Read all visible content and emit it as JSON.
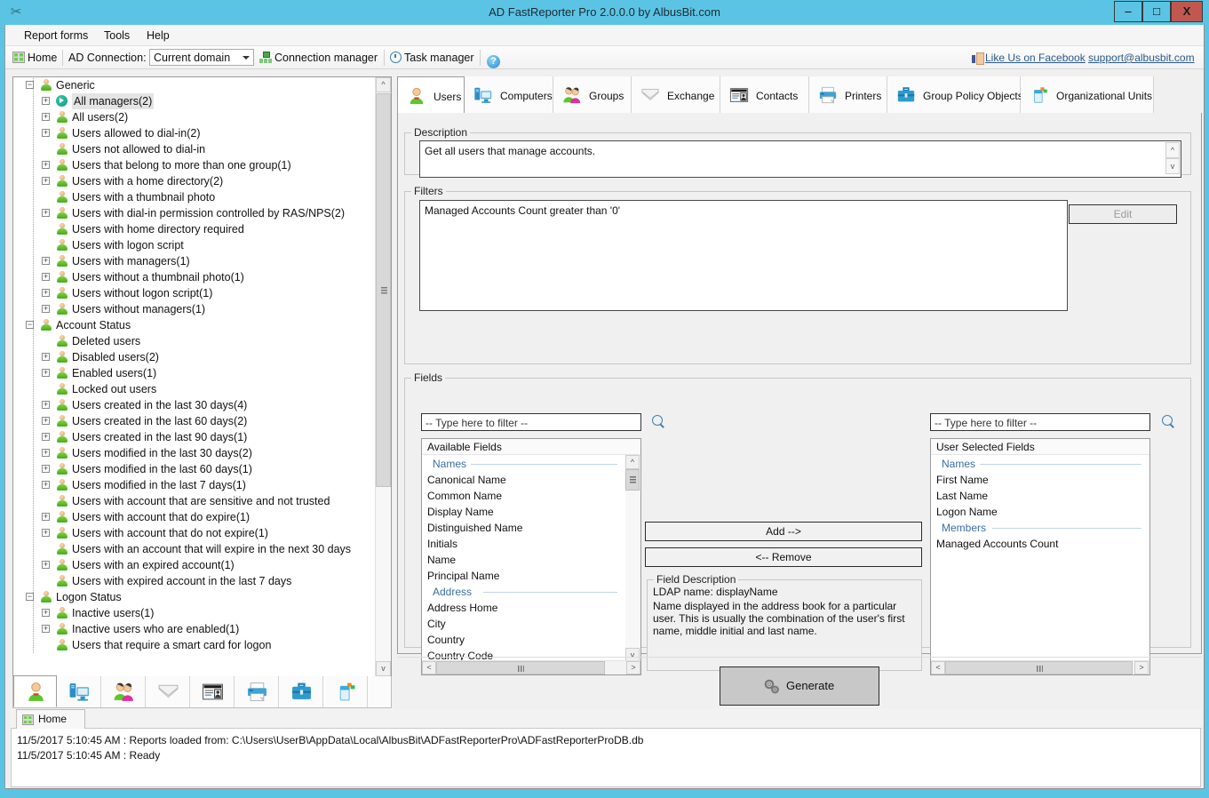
{
  "window": {
    "title": "AD FastReporter Pro 2.0.0.0 by AlbusBit.com",
    "app_icon": "scissors-icon",
    "minimize": "–",
    "maximize": "□",
    "close": "X",
    "titlebar_color": "#5bc4e4",
    "close_color": "#c1584f"
  },
  "menu": {
    "items": [
      {
        "label": "Report forms"
      },
      {
        "label": "Tools"
      },
      {
        "label": "Help"
      }
    ]
  },
  "toolbar": {
    "home": "Home",
    "connection_label": "AD Connection:",
    "connection_value": "Current domain",
    "connection_manager": "Connection manager",
    "task_manager": "Task manager",
    "help": "?",
    "facebook": "Like Us on Facebook",
    "support": "support@albusbit.com"
  },
  "tree": {
    "nodes": [
      {
        "label": "Generic",
        "depth": 0,
        "expander": "−",
        "icon": "person-icon",
        "selected": false
      },
      {
        "label": "All managers(2)",
        "depth": 1,
        "expander": "+",
        "icon": "arrow-circle-icon",
        "selected": true
      },
      {
        "label": "All users(2)",
        "depth": 1,
        "expander": "+",
        "icon": "person-icon",
        "selected": false
      },
      {
        "label": "Users allowed to dial-in(2)",
        "depth": 1,
        "expander": "+",
        "icon": "person-icon",
        "selected": false
      },
      {
        "label": "Users not allowed to dial-in",
        "depth": 1,
        "expander": "",
        "icon": "person-icon",
        "selected": false
      },
      {
        "label": "Users that belong to more than one group(1)",
        "depth": 1,
        "expander": "+",
        "icon": "person-icon",
        "selected": false
      },
      {
        "label": "Users with a home directory(2)",
        "depth": 1,
        "expander": "+",
        "icon": "person-icon",
        "selected": false
      },
      {
        "label": "Users with a thumbnail photo",
        "depth": 1,
        "expander": "",
        "icon": "person-icon",
        "selected": false
      },
      {
        "label": "Users with dial-in permission controlled by RAS/NPS(2)",
        "depth": 1,
        "expander": "+",
        "icon": "person-icon",
        "selected": false
      },
      {
        "label": "Users with home directory required",
        "depth": 1,
        "expander": "",
        "icon": "person-icon",
        "selected": false
      },
      {
        "label": "Users with logon script",
        "depth": 1,
        "expander": "",
        "icon": "person-icon",
        "selected": false
      },
      {
        "label": "Users with managers(1)",
        "depth": 1,
        "expander": "+",
        "icon": "person-icon",
        "selected": false
      },
      {
        "label": "Users without a thumbnail photo(1)",
        "depth": 1,
        "expander": "+",
        "icon": "person-icon",
        "selected": false
      },
      {
        "label": "Users without logon script(1)",
        "depth": 1,
        "expander": "+",
        "icon": "person-icon",
        "selected": false
      },
      {
        "label": "Users without managers(1)",
        "depth": 1,
        "expander": "+",
        "icon": "person-icon",
        "selected": false
      },
      {
        "label": "Account Status",
        "depth": 0,
        "expander": "−",
        "icon": "person-icon",
        "selected": false
      },
      {
        "label": "Deleted users",
        "depth": 1,
        "expander": "",
        "icon": "person-icon",
        "selected": false
      },
      {
        "label": "Disabled users(2)",
        "depth": 1,
        "expander": "+",
        "icon": "person-icon",
        "selected": false
      },
      {
        "label": "Enabled users(1)",
        "depth": 1,
        "expander": "+",
        "icon": "person-icon",
        "selected": false
      },
      {
        "label": "Locked out users",
        "depth": 1,
        "expander": "",
        "icon": "person-icon",
        "selected": false
      },
      {
        "label": "Users created in the last 30 days(4)",
        "depth": 1,
        "expander": "+",
        "icon": "person-icon",
        "selected": false
      },
      {
        "label": "Users created in the last 60 days(2)",
        "depth": 1,
        "expander": "+",
        "icon": "person-icon",
        "selected": false
      },
      {
        "label": "Users created in the last 90 days(1)",
        "depth": 1,
        "expander": "+",
        "icon": "person-icon",
        "selected": false
      },
      {
        "label": "Users modified in the last 30 days(2)",
        "depth": 1,
        "expander": "+",
        "icon": "person-icon",
        "selected": false
      },
      {
        "label": "Users modified in the last 60 days(1)",
        "depth": 1,
        "expander": "+",
        "icon": "person-icon",
        "selected": false
      },
      {
        "label": "Users modified in the last 7 days(1)",
        "depth": 1,
        "expander": "+",
        "icon": "person-icon",
        "selected": false
      },
      {
        "label": "Users with account that are sensitive and not trusted",
        "depth": 1,
        "expander": "",
        "icon": "person-icon",
        "selected": false
      },
      {
        "label": "Users with account that do expire(1)",
        "depth": 1,
        "expander": "+",
        "icon": "person-icon",
        "selected": false
      },
      {
        "label": "Users with account that do not expire(1)",
        "depth": 1,
        "expander": "+",
        "icon": "person-icon",
        "selected": false
      },
      {
        "label": "Users with an account that will expire in the next 30 days",
        "depth": 1,
        "expander": "",
        "icon": "person-icon",
        "selected": false
      },
      {
        "label": "Users with an expired account(1)",
        "depth": 1,
        "expander": "+",
        "icon": "person-icon",
        "selected": false
      },
      {
        "label": "Users with expired account in the last 7 days",
        "depth": 1,
        "expander": "",
        "icon": "person-icon",
        "selected": false
      },
      {
        "label": "Logon Status",
        "depth": 0,
        "expander": "−",
        "icon": "person-icon",
        "selected": false
      },
      {
        "label": "Inactive users(1)",
        "depth": 1,
        "expander": "+",
        "icon": "person-icon",
        "selected": false
      },
      {
        "label": "Inactive users who are enabled(1)",
        "depth": 1,
        "expander": "+",
        "icon": "person-icon",
        "selected": false
      },
      {
        "label": "Users that require a smart card for logon",
        "depth": 1,
        "expander": "",
        "icon": "person-icon",
        "selected": false
      }
    ]
  },
  "object_tabs": [
    {
      "label": "Users",
      "icon": "user-icon",
      "active": true
    },
    {
      "label": "Computers",
      "icon": "computer-icon",
      "active": false
    },
    {
      "label": "Groups",
      "icon": "group-icon",
      "active": false
    },
    {
      "label": "Exchange",
      "icon": "envelope-icon",
      "active": false
    },
    {
      "label": "Contacts",
      "icon": "contact-card-icon",
      "active": false
    },
    {
      "label": "Printers",
      "icon": "printer-icon",
      "active": false
    },
    {
      "label": "Group Policy Objects",
      "icon": "briefcase-icon",
      "active": false
    },
    {
      "label": "Organizational Units",
      "icon": "ou-icon",
      "active": false
    }
  ],
  "description": {
    "legend": "Description",
    "text": "Get all users that manage accounts."
  },
  "filters": {
    "legend": "Filters",
    "text": "Managed Accounts Count greater than '0'",
    "edit_label": "Edit",
    "edit_disabled": true
  },
  "fields": {
    "legend": "Fields",
    "left_filter_placeholder": "-- Type here to filter --",
    "right_filter_placeholder": "-- Type here to filter --",
    "available_header": "Available Fields",
    "selected_header": "User Selected Fields",
    "available": [
      {
        "type": "group",
        "label": "Names"
      },
      {
        "type": "item",
        "label": "Canonical Name"
      },
      {
        "type": "item",
        "label": "Common Name"
      },
      {
        "type": "item",
        "label": "Display Name"
      },
      {
        "type": "item",
        "label": "Distinguished Name"
      },
      {
        "type": "item",
        "label": "Initials"
      },
      {
        "type": "item",
        "label": "Name"
      },
      {
        "type": "item",
        "label": "Principal Name"
      },
      {
        "type": "group",
        "label": "Address"
      },
      {
        "type": "item",
        "label": "Address Home"
      },
      {
        "type": "item",
        "label": "City"
      },
      {
        "type": "item",
        "label": "Country"
      },
      {
        "type": "item",
        "label": "Country Code"
      }
    ],
    "selected": [
      {
        "type": "group",
        "label": "Names"
      },
      {
        "type": "item",
        "label": "First Name"
      },
      {
        "type": "item",
        "label": "Last Name"
      },
      {
        "type": "item",
        "label": "Logon Name"
      },
      {
        "type": "group",
        "label": "Members"
      },
      {
        "type": "item",
        "label": "Managed Accounts Count"
      }
    ],
    "add_label": "Add -->",
    "remove_label": "<-- Remove",
    "field_description": {
      "legend": "Field Description",
      "ldap": "LDAP name: displayName",
      "body": "Name displayed in the address book for a particular user. This is usually the combination of the user's first name, middle initial and last name."
    }
  },
  "generate": {
    "label": "Generate",
    "icon": "gears-icon"
  },
  "bottom_icon_tabs": [
    {
      "icon": "user-icon",
      "active": true
    },
    {
      "icon": "computer-icon",
      "active": false
    },
    {
      "icon": "group-icon",
      "active": false
    },
    {
      "icon": "envelope-icon",
      "active": false
    },
    {
      "icon": "contact-card-icon",
      "active": false
    },
    {
      "icon": "printer-icon",
      "active": false
    },
    {
      "icon": "briefcase-icon",
      "active": false
    },
    {
      "icon": "ou-icon",
      "active": false
    }
  ],
  "bottom_tab": {
    "label": "Home",
    "icon": "home-icon"
  },
  "status": {
    "lines": [
      "11/5/2017 5:10:45 AM : Reports loaded from: C:\\Users\\UserB\\AppData\\Local\\AlbusBit\\ADFastReporterPro\\ADFastReporterProDB.db",
      "11/5/2017 5:10:45 AM : Ready"
    ]
  }
}
